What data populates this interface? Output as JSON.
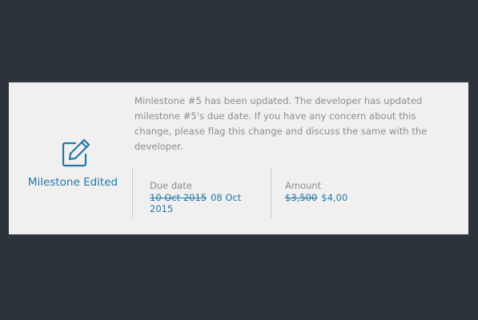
{
  "card": {
    "icon": "edit-icon",
    "status_label": "Milestone Edited",
    "message": "Minlestone #5 has been updated. The developer has updated milestone #5's due date. If you have any concern about this change, please flag this change and discuss the same with the developer.",
    "due_date": {
      "label": "Due date",
      "old_value": "10 Oct 2015",
      "new_value": "08 Oct 2015"
    },
    "amount": {
      "label": "Amount",
      "old_value": "$3,500",
      "new_value": "$4,00"
    }
  },
  "colors": {
    "background": "#2d333b",
    "card": "#f0f0f0",
    "accent": "#2378a8",
    "muted_text": "#8c8c8c"
  }
}
